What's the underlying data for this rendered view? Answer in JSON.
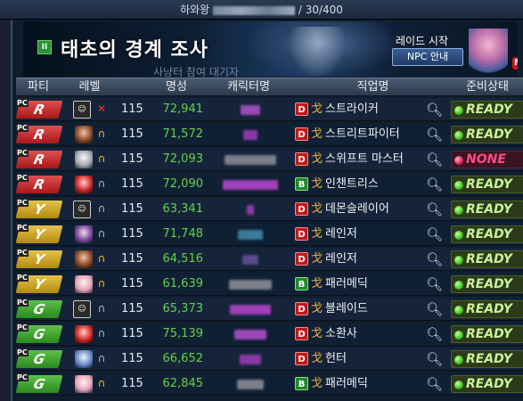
{
  "topbar": {
    "server": "하와왕",
    "count": "/ 30/400"
  },
  "banner": {
    "pause_icon": "pause-icon",
    "title": "태초의 경계 조사",
    "subtitle": "사냥터 참여 대기자",
    "raid_start": "레이드 시작",
    "npc_button": "NPC 안내"
  },
  "columns": [
    "파티",
    "레벨",
    "명성",
    "캐릭터명",
    "직업명",
    "준비상태"
  ],
  "colors": {
    "party_R": "#c82020",
    "party_Y": "#c9a020",
    "party_G": "#3aa02a",
    "fame": "#63d24a",
    "ready": "#c8f29a",
    "none": "#ff4a82"
  },
  "rows": [
    {
      "party": "R",
      "level": "115",
      "fame": "72,941",
      "headset": "mic-muted",
      "grade": "D",
      "cls": "스트라이커",
      "status": "READY",
      "name_color": "#9b4bb8",
      "name_width": 22,
      "avatar": "card"
    },
    {
      "party": "R",
      "level": "115",
      "fame": "71,572",
      "headset": "on",
      "grade": "D",
      "cls": "스트리트파이터",
      "status": "READY",
      "name_color": "#8a3aa8",
      "name_width": 16,
      "avatar": "brown"
    },
    {
      "party": "R",
      "level": "115",
      "fame": "72,093",
      "headset": "on",
      "grade": "D",
      "cls": "스위프트 마스터",
      "status": "NONE",
      "name_color": "#7a7f8a",
      "name_width": 58,
      "avatar": "white"
    },
    {
      "party": "R",
      "level": "115",
      "fame": "72,090",
      "headset": "off",
      "grade": "B",
      "cls": "인챈트리스",
      "status": "READY",
      "name_color": "#a040b8",
      "name_width": 62,
      "avatar": "red"
    },
    {
      "party": "Y",
      "level": "115",
      "fame": "63,341",
      "headset": "off",
      "grade": "D",
      "cls": "데몬슬레이어",
      "status": "READY",
      "name_color": "#8a3aa8",
      "name_width": 8,
      "avatar": "card"
    },
    {
      "party": "Y",
      "level": "115",
      "fame": "71,748",
      "headset": "off",
      "grade": "D",
      "cls": "레인저",
      "status": "READY",
      "name_color": "#3a7a9a",
      "name_width": 28,
      "avatar": "purple"
    },
    {
      "party": "Y",
      "level": "115",
      "fame": "64,516",
      "headset": "on",
      "grade": "D",
      "cls": "레인저",
      "status": "READY",
      "name_color": "#5a4a8a",
      "name_width": 18,
      "avatar": "brown"
    },
    {
      "party": "Y",
      "level": "115",
      "fame": "61,639",
      "headset": "on",
      "grade": "B",
      "cls": "패러메딕",
      "status": "READY",
      "name_color": "#7a7f8a",
      "name_width": 48,
      "avatar": "pink"
    },
    {
      "party": "G",
      "level": "115",
      "fame": "65,373",
      "headset": "off",
      "grade": "D",
      "cls": "블레이드",
      "status": "READY",
      "name_color": "#a040b8",
      "name_width": 46,
      "avatar": "card"
    },
    {
      "party": "G",
      "level": "115",
      "fame": "75,139",
      "headset": "off",
      "grade": "D",
      "cls": "소환사",
      "status": "READY",
      "name_color": "#9b4bb8",
      "name_width": 36,
      "avatar": "red"
    },
    {
      "party": "G",
      "level": "115",
      "fame": "66,652",
      "headset": "off",
      "grade": "D",
      "cls": "헌터",
      "status": "READY",
      "name_color": "#8a3aa8",
      "name_width": 24,
      "avatar": "blue"
    },
    {
      "party": "G",
      "level": "115",
      "fame": "62,845",
      "headset": "on",
      "grade": "B",
      "cls": "패러메딕",
      "status": "READY",
      "name_color": "#7a7f8a",
      "name_width": 30,
      "avatar": "pink"
    }
  ]
}
